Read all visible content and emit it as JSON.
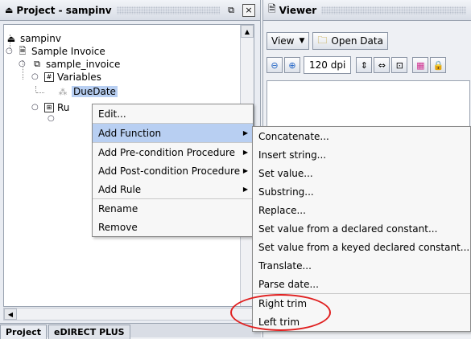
{
  "project": {
    "title": "Project - sampinv",
    "tree": [
      {
        "label": "sampinv"
      },
      {
        "label": "Sample Invoice"
      },
      {
        "label": "sample_invoice"
      },
      {
        "label": "Variables"
      },
      {
        "label": "DueDate"
      },
      {
        "label": "Ru"
      }
    ],
    "tabs": [
      "Project",
      "eDIRECT PLUS"
    ]
  },
  "viewer": {
    "title": "Viewer",
    "view_label": "View",
    "open_data_label": "Open Data",
    "dpi": "120 dpi"
  },
  "context_menu": {
    "items": [
      {
        "label": "Edit..."
      },
      {
        "label": "Add Function",
        "submenu": true,
        "active": true
      },
      {
        "label": "Add Pre-condition Procedure",
        "submenu": true
      },
      {
        "label": "Add Post-condition Procedure",
        "submenu": true
      },
      {
        "label": "Add Rule",
        "submenu": true
      },
      {
        "label": "Rename"
      },
      {
        "label": "Remove"
      }
    ]
  },
  "function_menu": {
    "items": [
      {
        "label": "Concatenate..."
      },
      {
        "label": "Insert string..."
      },
      {
        "label": "Set value..."
      },
      {
        "label": "Substring..."
      },
      {
        "label": "Replace..."
      },
      {
        "label": "Set value from a declared constant..."
      },
      {
        "label": "Set value from a keyed declared constant..."
      },
      {
        "label": "Translate..."
      },
      {
        "label": "Parse date..."
      },
      {
        "label": "Right trim"
      },
      {
        "label": "Left trim"
      }
    ]
  },
  "annotation": {
    "color": "#e02020"
  },
  "colors": {
    "selection": "#b8cff2"
  }
}
